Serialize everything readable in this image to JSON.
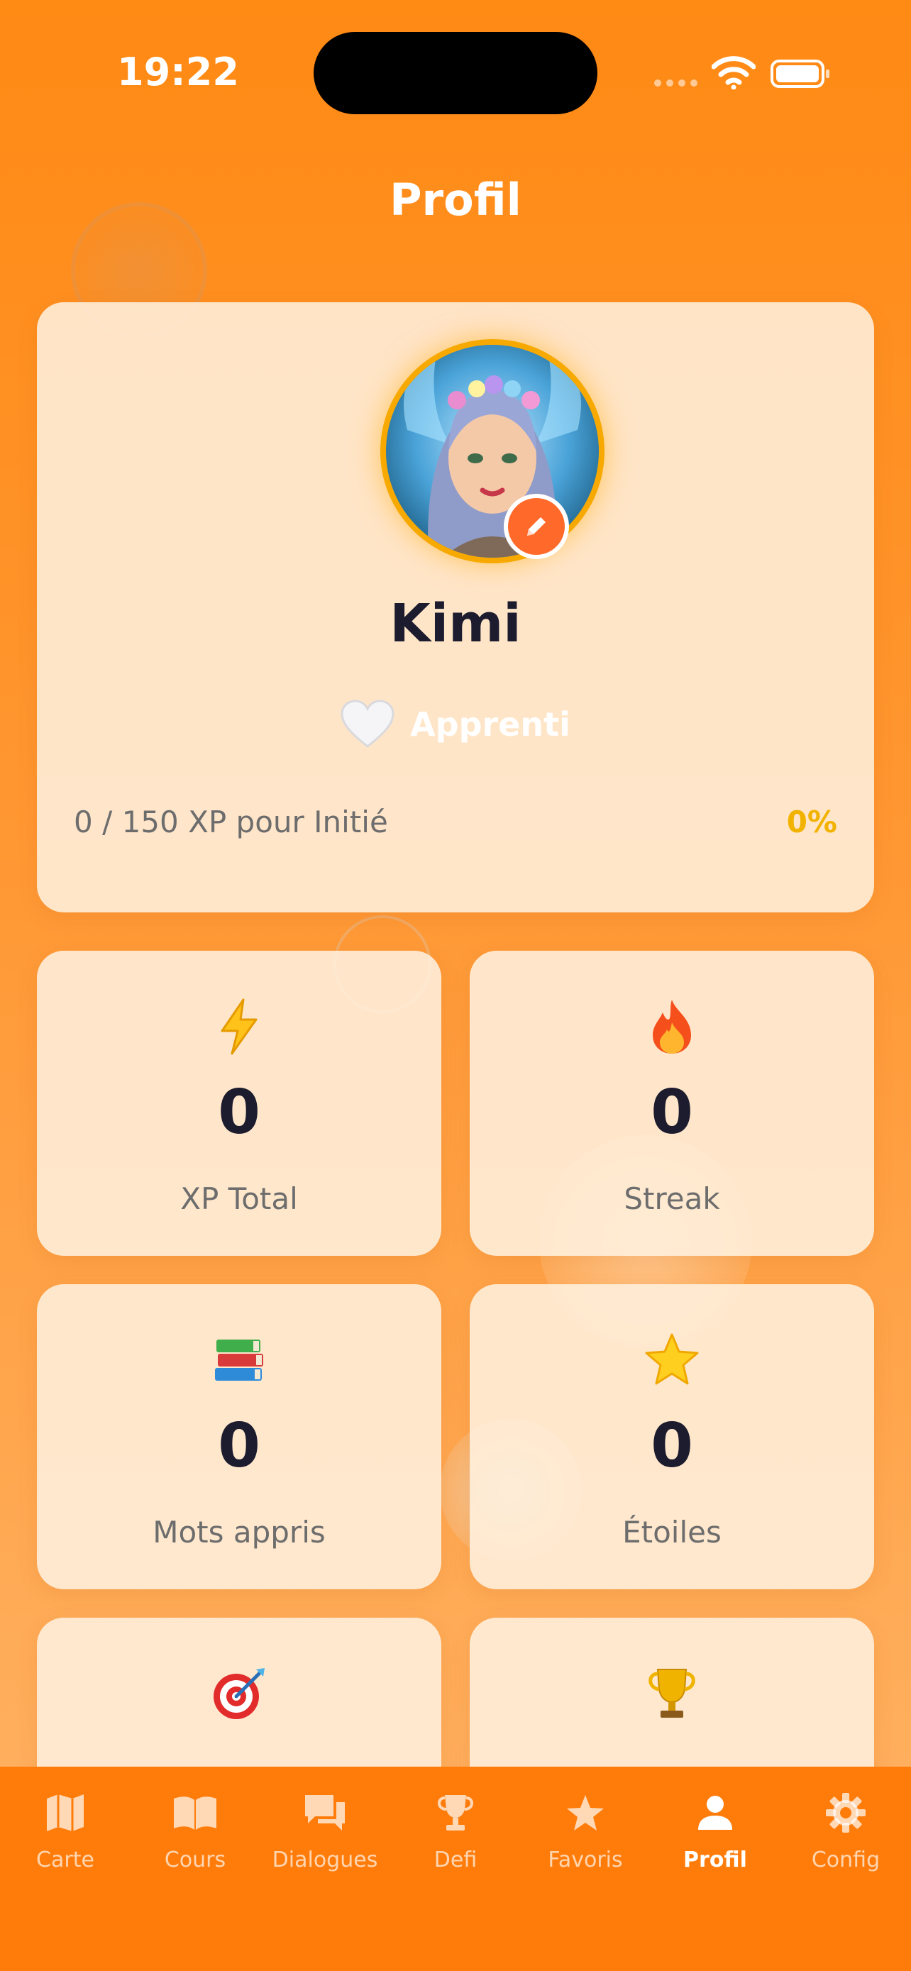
{
  "status_bar": {
    "time": "19:22"
  },
  "header": {
    "title": "Profil"
  },
  "profile": {
    "name": "Kimi",
    "rank_icon": "white-heart",
    "rank": "Apprenti",
    "xp_progress": "0 / 150 XP pour Initié",
    "xp_percent": "0%",
    "progress_fraction": 0
  },
  "stats": [
    {
      "icon": "lightning-icon",
      "value": "0",
      "label": "XP Total"
    },
    {
      "icon": "fire-icon",
      "value": "0",
      "label": "Streak"
    },
    {
      "icon": "books-icon",
      "value": "0",
      "label": "Mots appris"
    },
    {
      "icon": "star-icon",
      "value": "0",
      "label": "Étoiles"
    },
    {
      "icon": "target-icon"
    },
    {
      "icon": "trophy-icon"
    }
  ],
  "tabs": [
    {
      "label": "Carte",
      "icon": "map-icon"
    },
    {
      "label": "Cours",
      "icon": "book-icon"
    },
    {
      "label": "Dialogues",
      "icon": "chat-icon"
    },
    {
      "label": "Defi",
      "icon": "trophy-icon"
    },
    {
      "label": "Favoris",
      "icon": "star-icon"
    },
    {
      "label": "Profil",
      "icon": "person-icon",
      "active": true
    },
    {
      "label": "Config",
      "icon": "gear-icon"
    }
  ],
  "colors": {
    "background": "#ff8a14",
    "tab_bar": "#ff7c0a",
    "accent": "#f2b300",
    "edit_badge": "#ff6a2a"
  }
}
